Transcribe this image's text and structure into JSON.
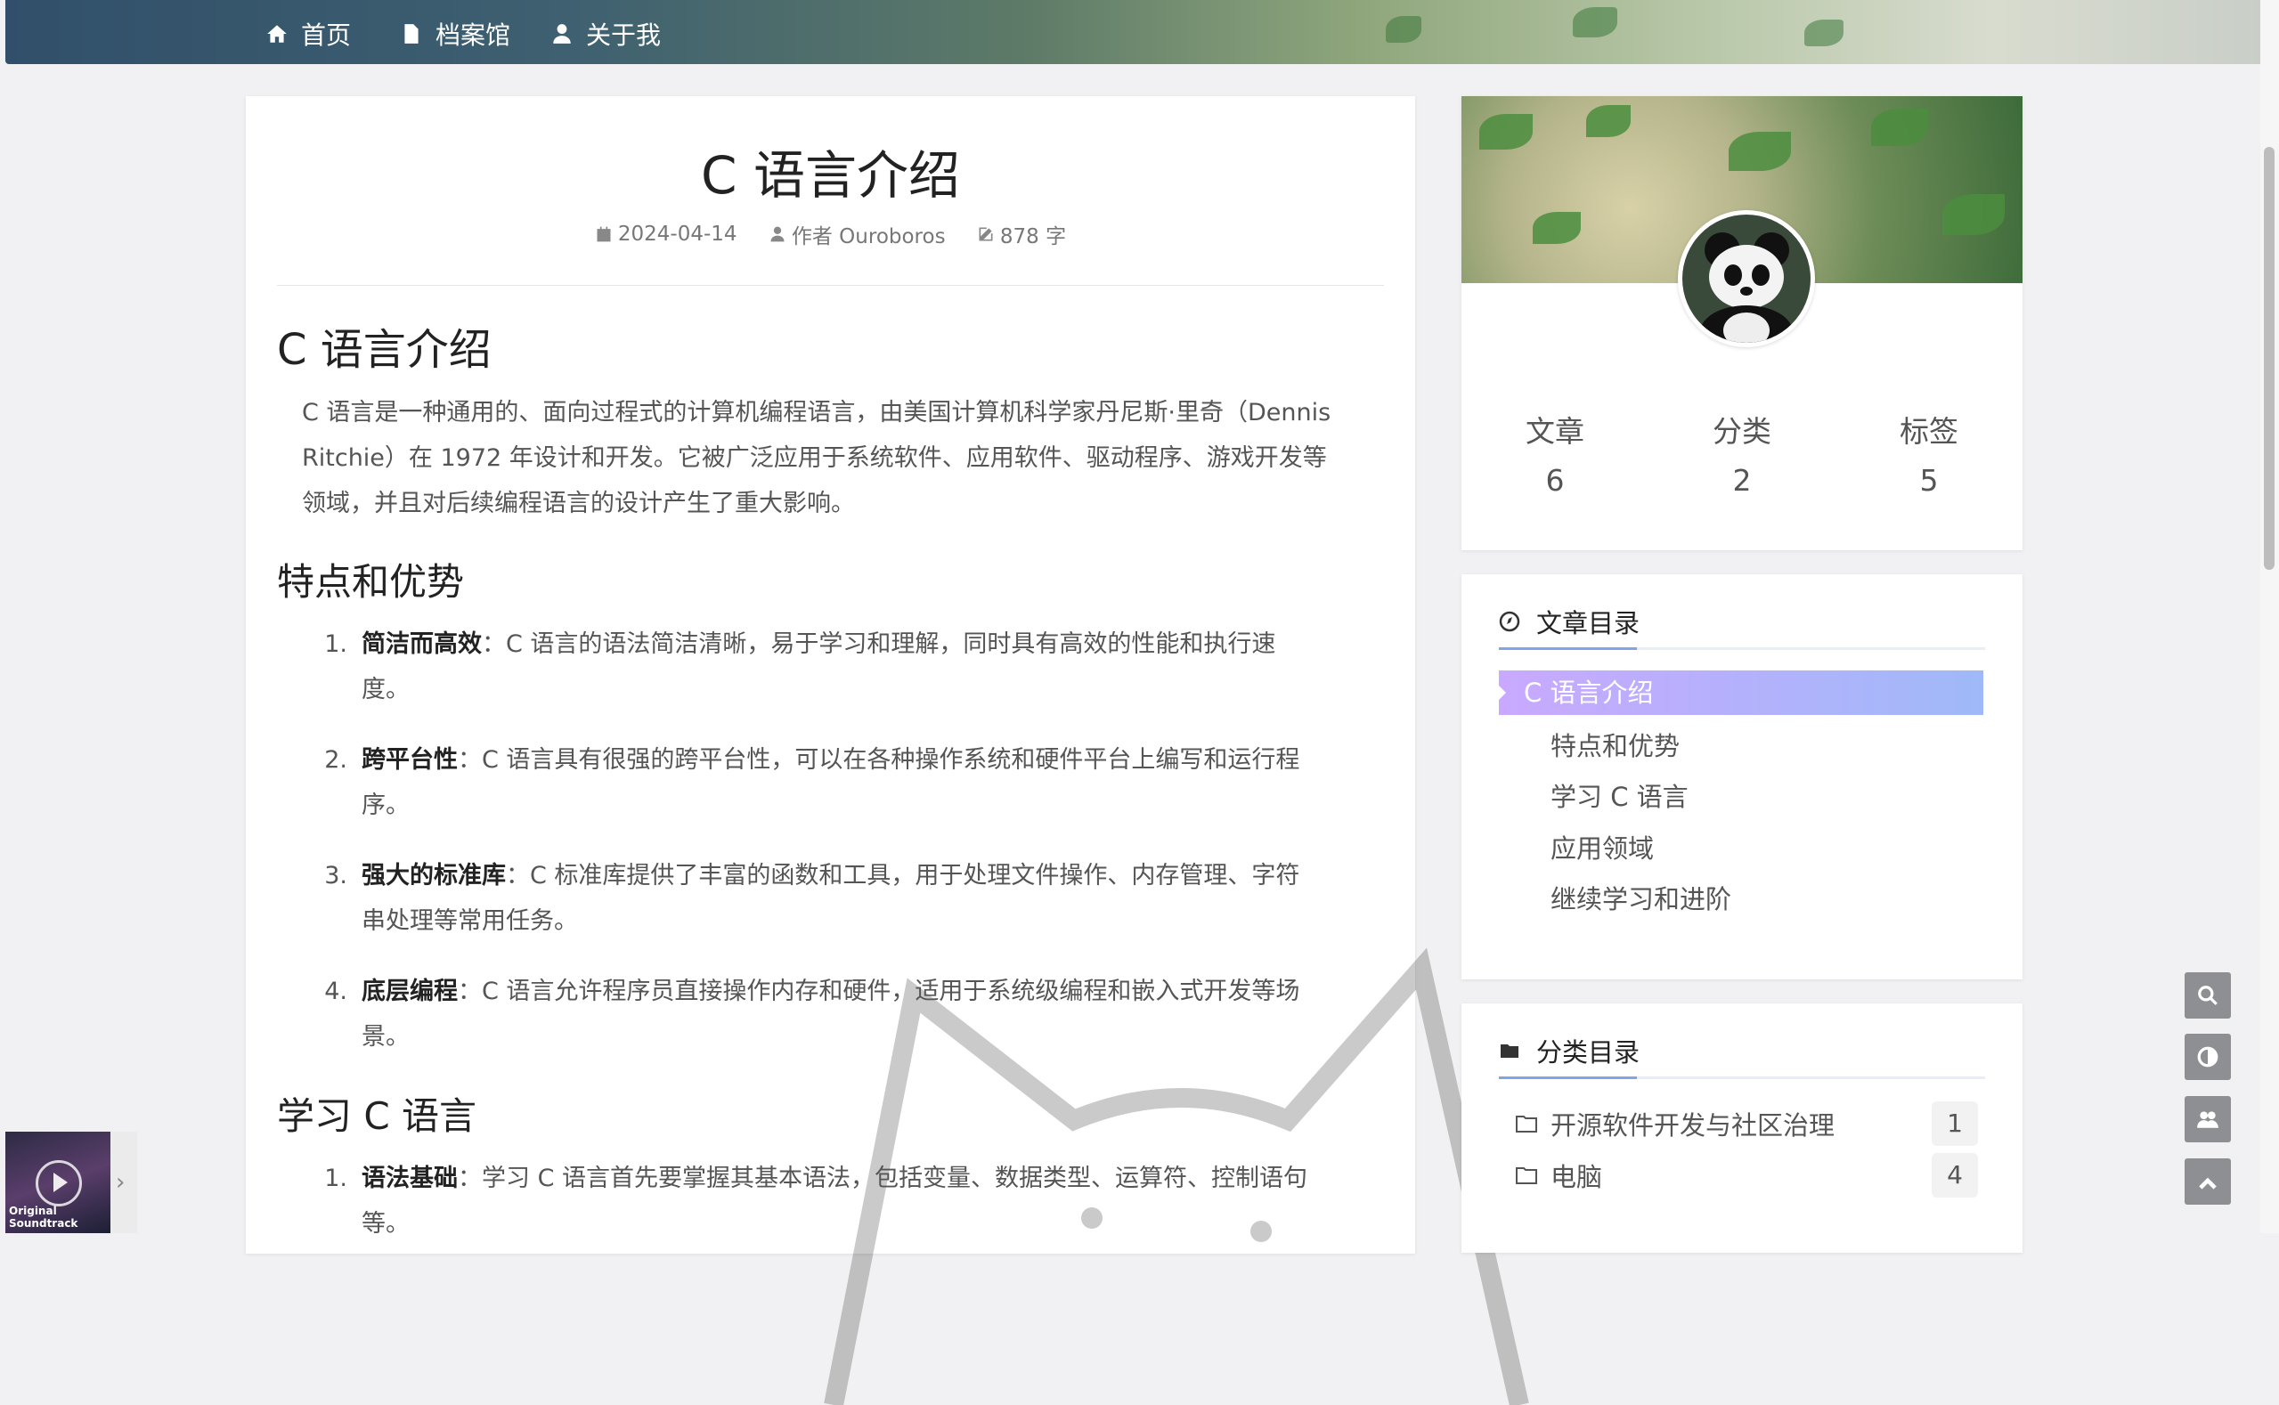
{
  "nav": {
    "home": "首页",
    "archive": "档案馆",
    "about": "关于我"
  },
  "post": {
    "title": "C 语言介绍",
    "date": "2024-04-14",
    "author": "作者 Ouroboros",
    "words": "878 字",
    "h_intro": "C 语言介绍",
    "intro_lines": [
      "C 语言是一种通用的、面向过程式的计算机编程语言，由美国计算机科学家丹尼斯·里奇（Dennis",
      "Ritchie）在 1972 年设计和开发。它被广泛应用于系统软件、应用软件、驱动程序、游戏开发等",
      "领域，并且对后续编程语言的设计产生了重大影响。"
    ],
    "h_features": "特点和优势",
    "features": [
      {
        "num": "1.",
        "term": "简洁而高效",
        "line1": "：C 语言的语法简洁清晰，易于学习和理解，同时具有高效的性能和执行速",
        "line2": "度。"
      },
      {
        "num": "2.",
        "term": "跨平台性",
        "line1": "：C 语言具有很强的跨平台性，可以在各种操作系统和硬件平台上编写和运行程",
        "line2": "序。"
      },
      {
        "num": "3.",
        "term": "强大的标准库",
        "line1": "：C 标准库提供了丰富的函数和工具，用于处理文件操作、内存管理、字符",
        "line2": "串处理等常用任务。"
      },
      {
        "num": "4.",
        "term": "底层编程",
        "line1": "：C 语言允许程序员直接操作内存和硬件，适用于系统级编程和嵌入式开发等场",
        "line2": "景。"
      }
    ],
    "h_learn": "学习 C 语言",
    "learn": [
      {
        "num": "1.",
        "term": "语法基础",
        "line1": "：学习 C 语言首先要掌握其基本语法，包括变量、数据类型、运算符、控制语句",
        "line2": "等。"
      }
    ]
  },
  "profile": {
    "stats": [
      {
        "label": "文章",
        "value": "6"
      },
      {
        "label": "分类",
        "value": "2"
      },
      {
        "label": "标签",
        "value": "5"
      }
    ]
  },
  "toc": {
    "title": "文章目录",
    "active": "C 语言介绍",
    "items": [
      "特点和优势",
      "学习 C 语言",
      "应用领域",
      "继续学习和进阶"
    ]
  },
  "categories": {
    "title": "分类目录",
    "items": [
      {
        "name": "开源软件开发与社区治理",
        "count": "1"
      },
      {
        "name": "电脑",
        "count": "4"
      }
    ]
  },
  "player": {
    "caption": "Original Soundtrack"
  },
  "colors": {
    "toc_active_start": "#c9a9ff",
    "toc_active_end": "#9fb9f8",
    "accent_line": "#7fa6ea",
    "float_button": "#8d8f93"
  },
  "icons": {
    "home": "home-icon",
    "archive": "file-icon",
    "about": "user-icon",
    "date": "calendar-icon",
    "author": "user-icon",
    "words": "edit-icon",
    "toc": "compass-icon",
    "categories": "folder-icon",
    "search": "search-icon",
    "theme": "contrast-icon",
    "friends": "group-icon",
    "top": "chevron-up-icon"
  }
}
